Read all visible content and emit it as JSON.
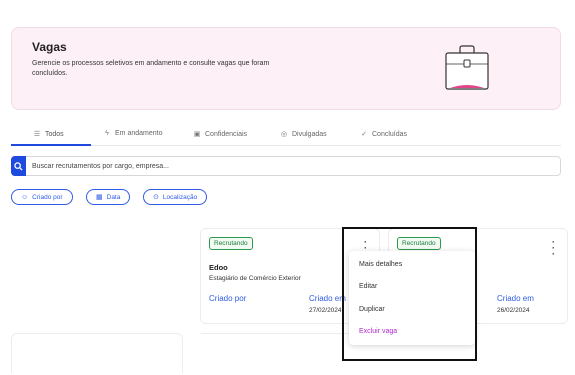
{
  "hero": {
    "title": "Vagas",
    "description": "Gerencie os processos seletivos em andamento e consulte vagas que foram concluídos."
  },
  "tabs": [
    {
      "label": "Todos",
      "icon": "list-icon",
      "active": true
    },
    {
      "label": "Em andamento",
      "icon": "bolt-icon",
      "active": false
    },
    {
      "label": "Confidenciais",
      "icon": "lock-icon",
      "active": false
    },
    {
      "label": "Divulgadas",
      "icon": "globe-icon",
      "active": false
    },
    {
      "label": "Concluídas",
      "icon": "check-icon",
      "active": false
    }
  ],
  "search": {
    "placeholder": "Buscar recrutamentos por cargo, empresa..."
  },
  "filters": [
    {
      "label": "Criado por",
      "icon": "user-icon"
    },
    {
      "label": "Data",
      "icon": "calendar-icon"
    },
    {
      "label": "Localização",
      "icon": "location-pin-icon"
    }
  ],
  "cards": [
    {
      "badge": "Recrutando",
      "company": "Edoo",
      "role": "Estagiário de Comércio Exterior",
      "creator_label": "Criado por",
      "created_label": "Criado em",
      "date": "27/02/2024"
    },
    {
      "badge": "Recrutando",
      "created_label": "Criado em",
      "date": "26/02/2024"
    }
  ],
  "menu": {
    "items": [
      "Mais detalhes",
      "Editar",
      "Duplicar",
      "Excluir vaga"
    ]
  },
  "colors": {
    "accent": "#1f4ae0",
    "hero_bg": "#fdf0f6",
    "badge_green": "#2e9a4e",
    "danger": "#b12ac9"
  }
}
